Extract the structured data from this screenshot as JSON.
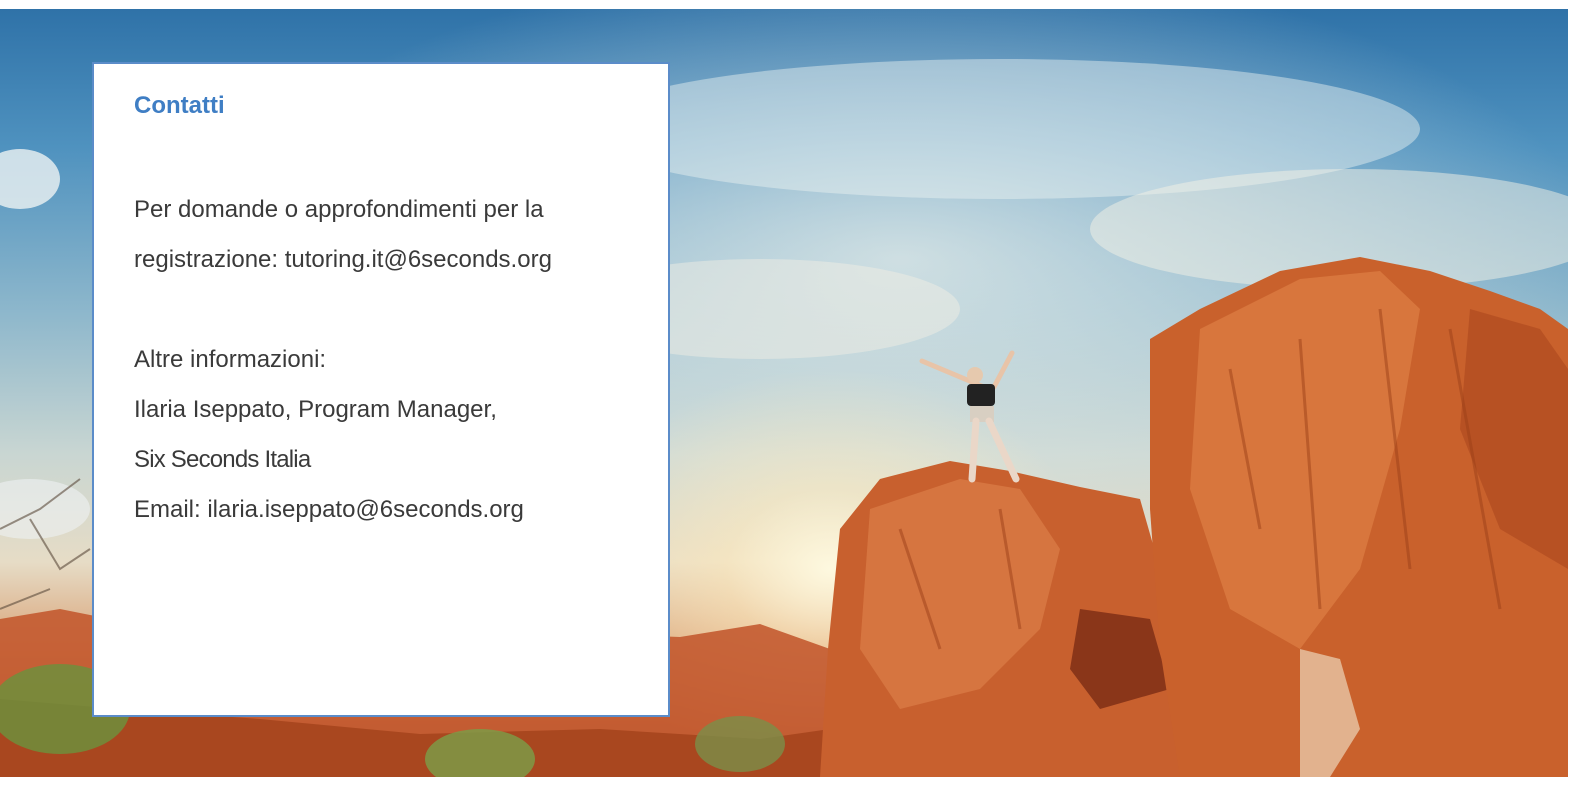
{
  "hero": {
    "image": "desert-canyon-celebration-photo",
    "colors": {
      "sky_top": "#2f72a8",
      "sky_haze": "#c9d6d2",
      "rock": "#c8602e",
      "rock_dark": "#8c3a1c",
      "sun_glow": "#fff6dc"
    }
  },
  "contact_card": {
    "title": "Contatti",
    "title_color": "#3f7ec4",
    "border_color": "#5b8cc9",
    "registration_line1": "Per domande o approfondimenti per la",
    "registration_line2": "registrazione: tutoring.it@6seconds.org",
    "more_info_label": "Altre informazioni:",
    "contact_name_line": "Ilaria Iseppato, Program Manager,",
    "contact_org": "Six Seconds Italia",
    "contact_email_line": "Email: ilaria.iseppato@6seconds.org"
  }
}
